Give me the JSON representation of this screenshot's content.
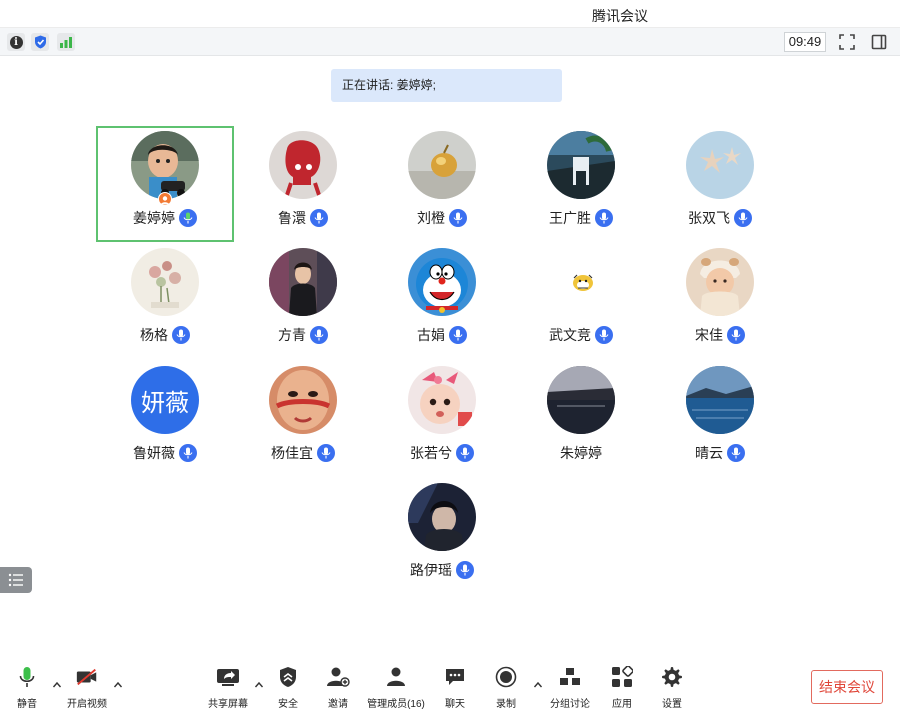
{
  "window": {
    "title": "腾讯会议"
  },
  "topbar": {
    "clock": "09:49"
  },
  "speaker": {
    "label": "正在讲话: ",
    "name": "姜婷婷;"
  },
  "participants": [
    {
      "name": "姜婷婷",
      "avatar": "photo-child-toy-car",
      "mic": "active-green",
      "host": true
    },
    {
      "name": "鲁澴",
      "avatar": "photo-red-cartoon",
      "mic": "on"
    },
    {
      "name": "刘橙",
      "avatar": "photo-gold-ornament",
      "mic": "on"
    },
    {
      "name": "王广胜",
      "avatar": "photo-chairs-outdoor",
      "mic": "on"
    },
    {
      "name": "张双飞",
      "avatar": "photo-starfish",
      "mic": "on"
    },
    {
      "name": "杨格",
      "avatar": "photo-flower-drawing",
      "mic": "on"
    },
    {
      "name": "方青",
      "avatar": "photo-woman-shop",
      "mic": "on"
    },
    {
      "name": "古娟",
      "avatar": "cartoon-doraemon",
      "mic": "on"
    },
    {
      "name": "武文竞",
      "avatar": "small-tiger-emoji",
      "mic": "on"
    },
    {
      "name": "宋佳",
      "avatar": "photo-baby-hat",
      "mic": "on"
    },
    {
      "name": "鲁妍薇",
      "avatar": "text-avatar",
      "avatar_text": "妍薇",
      "mic": "on"
    },
    {
      "name": "杨佳宜",
      "avatar": "photo-face-paint",
      "mic": "on"
    },
    {
      "name": "张若兮",
      "avatar": "photo-baby-pink-bow",
      "mic": "on"
    },
    {
      "name": "朱婷婷",
      "avatar": "photo-lake-sunset",
      "mic": "none"
    },
    {
      "name": "晴云",
      "avatar": "photo-lake-blue",
      "mic": "on"
    },
    {
      "name": "路伊瑶",
      "avatar": "photo-girl-dark",
      "mic": "on"
    }
  ],
  "toolbar": {
    "mute_label": "静音",
    "video_label": "开启视频",
    "share_label": "共享屏幕",
    "security_label": "安全",
    "invite_label": "邀请",
    "members_label": "管理成员(16)",
    "chat_label": "聊天",
    "record_label": "录制",
    "breakout_label": "分组讨论",
    "apps_label": "应用",
    "settings_label": "设置",
    "end_label": "结束会议"
  },
  "colors": {
    "accent": "#3a6ff0",
    "active_border": "#5ec270",
    "end_red": "#e0473a",
    "speaker_bg": "#dbe8fb"
  }
}
